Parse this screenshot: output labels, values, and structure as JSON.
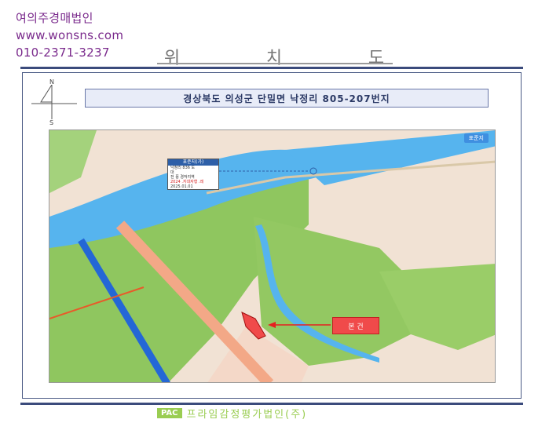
{
  "watermark": {
    "company": "여의주경매법인",
    "website": "www.wonsns.com",
    "phone": "010-2371-3237"
  },
  "document": {
    "title_chars": [
      "위",
      "치",
      "도"
    ],
    "address": "경상북도 의성군 단밀면 낙정리 805-207번지",
    "compass": {
      "north": "N",
      "south": "S"
    }
  },
  "map": {
    "badge": "표준지",
    "callout": {
      "header": "표준지(가)",
      "lines": [
        "낙정리 836 도",
        "대",
        "전 풍 경작지역",
        "2024 .지대자형 .레",
        "2025.01.01"
      ]
    },
    "subject_label": "본 건"
  },
  "footer": {
    "logo": "PAC",
    "company": "프라임감정평가법인(주)"
  },
  "colors": {
    "water": "#56b4ee",
    "farmland": "#8fc65f",
    "frame": "#3b4b7c",
    "subject": "#f04a4a"
  }
}
